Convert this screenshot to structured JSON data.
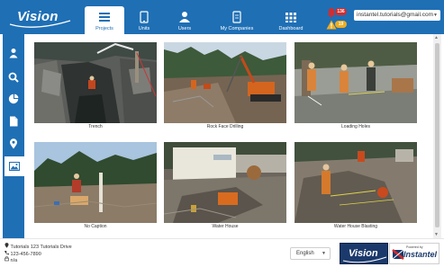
{
  "app": {
    "brand": "Vision",
    "brand_footer": "Vision",
    "powered_by": "Powered by",
    "company": "Instantel"
  },
  "nav": {
    "items": [
      {
        "label": "Projects",
        "icon": "list-icon",
        "active": true
      },
      {
        "label": "Units",
        "icon": "tablet-icon",
        "active": false
      },
      {
        "label": "Users",
        "icon": "user-icon",
        "active": false
      },
      {
        "label": "My Companies",
        "icon": "document-icon",
        "active": false
      },
      {
        "label": "Dashboard",
        "icon": "grid-icon",
        "active": false
      }
    ]
  },
  "alerts": {
    "notifications_count": "136",
    "warnings_count": "19"
  },
  "user": {
    "email": "instantel.tutorials@gmail.com"
  },
  "sidebar": {
    "items": [
      {
        "icon": "user-icon",
        "active": false
      },
      {
        "icon": "search-icon",
        "active": false
      },
      {
        "icon": "pie-chart-icon",
        "active": false
      },
      {
        "icon": "file-icon",
        "active": false
      },
      {
        "icon": "map-pin-icon",
        "active": false
      },
      {
        "icon": "image-icon",
        "active": true
      }
    ]
  },
  "gallery": {
    "photos": [
      {
        "caption": "Trench"
      },
      {
        "caption": "Rock Face Drilling"
      },
      {
        "caption": "Loading Holes"
      },
      {
        "caption": "No Caption"
      },
      {
        "caption": "Water House"
      },
      {
        "caption": "Water House Blasting"
      }
    ]
  },
  "footer": {
    "address": "Tutorials 123 Tutorials Drive",
    "phone": "123-456-7890",
    "fax": "n/a",
    "language": "English"
  },
  "colors": {
    "brand_blue": "#1f6fb5",
    "alert_red": "#d42c2c",
    "warning_orange": "#f0ad1f",
    "footer_logo_navy": "#1b3a6b"
  }
}
